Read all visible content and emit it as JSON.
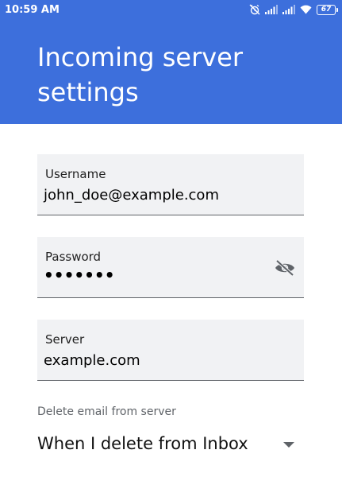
{
  "status_bar": {
    "time": "10:59 AM",
    "battery": "67",
    "icons": [
      "alarm-off-icon",
      "signal-icon",
      "signal-icon",
      "wifi-icon",
      "battery-icon"
    ]
  },
  "header": {
    "title": "Incoming server settings",
    "color": "#3d6fdc"
  },
  "form": {
    "username": {
      "label": "Username",
      "value": "john_doe@example.com"
    },
    "password": {
      "label": "Password",
      "value": "•••••••",
      "toggle_icon": "visibility-off-icon"
    },
    "server": {
      "label": "Server",
      "value": "example.com"
    },
    "delete_policy": {
      "label": "Delete email from server",
      "selected": "When I delete from Inbox"
    }
  }
}
